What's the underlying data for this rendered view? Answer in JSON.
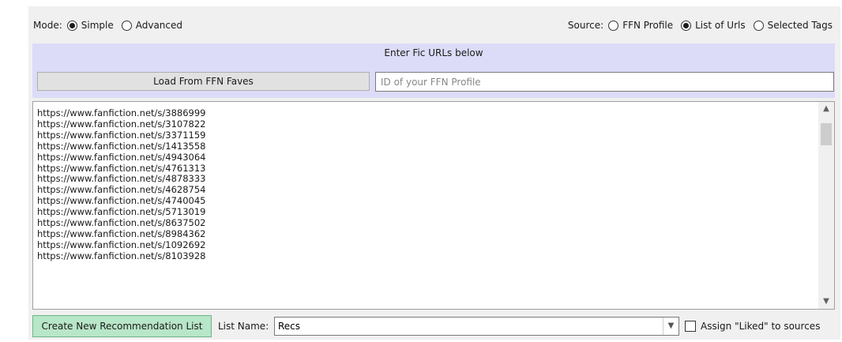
{
  "mode": {
    "label": "Mode:",
    "options": [
      {
        "label": "Simple",
        "checked": true
      },
      {
        "label": "Advanced",
        "checked": false
      }
    ]
  },
  "source": {
    "label": "Source:",
    "options": [
      {
        "label": "FFN Profile",
        "checked": false
      },
      {
        "label": "List of Urls",
        "checked": true
      },
      {
        "label": "Selected Tags",
        "checked": false
      }
    ]
  },
  "instructions": "Enter Fic URLs below",
  "load_button": "Load From FFN Faves",
  "profile_input": {
    "value": "",
    "placeholder": "ID of your FFN Profile"
  },
  "urls": [
    "https://www.fanfiction.net/s/3886999",
    "https://www.fanfiction.net/s/3107822",
    "https://www.fanfiction.net/s/3371159",
    "https://www.fanfiction.net/s/1413558",
    "https://www.fanfiction.net/s/4943064",
    "https://www.fanfiction.net/s/4761313",
    "https://www.fanfiction.net/s/4878333",
    "https://www.fanfiction.net/s/4628754",
    "https://www.fanfiction.net/s/4740045",
    "https://www.fanfiction.net/s/5713019",
    "https://www.fanfiction.net/s/8637502",
    "https://www.fanfiction.net/s/8984362",
    "https://www.fanfiction.net/s/1092692",
    "https://www.fanfiction.net/s/8103928"
  ],
  "scrollbar": {
    "up_icon": "chevron-up-icon",
    "down_icon": "chevron-down-icon"
  },
  "create_button": "Create New Recommendation List",
  "list_name": {
    "label": "List Name:",
    "value": "Recs",
    "dropdown_icon": "chevron-down-icon"
  },
  "assign_liked": {
    "label": "Assign \"Liked\" to sources",
    "checked": false
  },
  "colors": {
    "panel_background": "#f0f0f0",
    "instructions_background": "#dcdcf8",
    "create_button_background": "#b8e6c8"
  }
}
